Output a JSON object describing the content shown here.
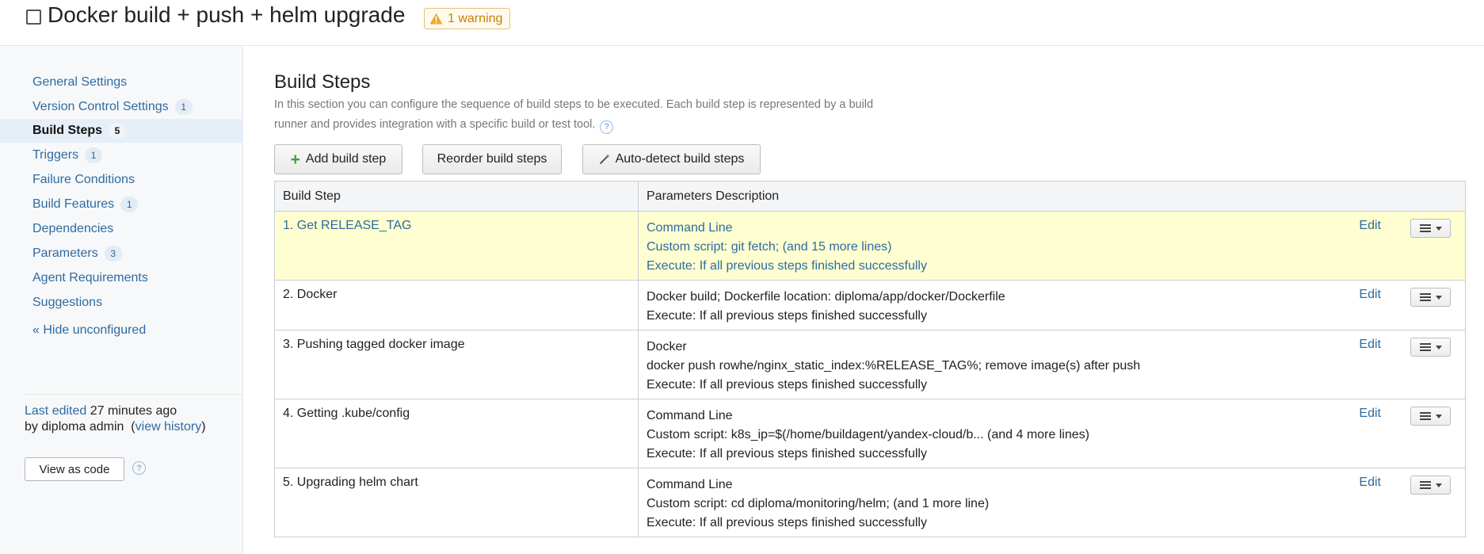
{
  "header": {
    "title": "Docker build + push + helm upgrade",
    "warning": "1 warning"
  },
  "sidebar": {
    "items": [
      {
        "label": "General Settings",
        "count": ""
      },
      {
        "label": "Version Control Settings",
        "count": "1"
      },
      {
        "label": "Build Steps",
        "count": "5"
      },
      {
        "label": "Triggers",
        "count": "1"
      },
      {
        "label": "Failure Conditions",
        "count": ""
      },
      {
        "label": "Build Features",
        "count": "1"
      },
      {
        "label": "Dependencies",
        "count": ""
      },
      {
        "label": "Parameters",
        "count": "3"
      },
      {
        "label": "Agent Requirements",
        "count": ""
      },
      {
        "label": "Suggestions",
        "count": ""
      }
    ],
    "hide_unconfigured": "« Hide unconfigured",
    "last_edited_prefix": "Last edited",
    "last_edited_time": "27 minutes ago",
    "last_edited_by": "by diploma admin",
    "view_history": "view history",
    "view_as_code": "View as code"
  },
  "main": {
    "title": "Build Steps",
    "description": "In this section you can configure the sequence of build steps to be executed. Each build step is represented by a build runner and provides integration with a specific build or test tool.",
    "buttons": {
      "add": "Add build step",
      "reorder": "Reorder build steps",
      "auto_detect": "Auto-detect build steps"
    },
    "table": {
      "headers": [
        "Build Step",
        "Parameters Description"
      ],
      "edit_label": "Edit",
      "rows": [
        {
          "name": "1. Get RELEASE_TAG",
          "lines": [
            "Command Line",
            "Custom script: git fetch; (and 15 more lines)",
            "Execute: If all previous steps finished successfully"
          ]
        },
        {
          "name": "2. Docker",
          "lines": [
            "Docker build; Dockerfile location: diploma/app/docker/Dockerfile",
            "Execute: If all previous steps finished successfully"
          ]
        },
        {
          "name": "3. Pushing tagged docker image",
          "lines": [
            "Docker",
            "docker push rowhe/nginx_static_index:%RELEASE_TAG%; remove image(s) after push",
            "Execute: If all previous steps finished successfully"
          ]
        },
        {
          "name": "4. Getting .kube/config",
          "lines": [
            "Command Line",
            "Custom script: k8s_ip=$(/home/buildagent/yandex-cloud/b... (and 4 more lines)",
            "Execute: If all previous steps finished successfully"
          ]
        },
        {
          "name": "5. Upgrading helm chart",
          "lines": [
            "Command Line",
            "Custom script: cd diploma/monitoring/helm; (and 1 more line)",
            "Execute: If all previous steps finished successfully"
          ]
        }
      ]
    }
  },
  "colors": {
    "link": "#2e6ba1",
    "highlight_row": "#fefed0",
    "warning": "#c77f00",
    "sidebar_bg": "#f7f8fa"
  },
  "icons": [
    "checkbox-icon",
    "warning-icon",
    "help-icon",
    "plus-icon",
    "magic-wand-icon",
    "list-icon",
    "caret-down-icon"
  ]
}
